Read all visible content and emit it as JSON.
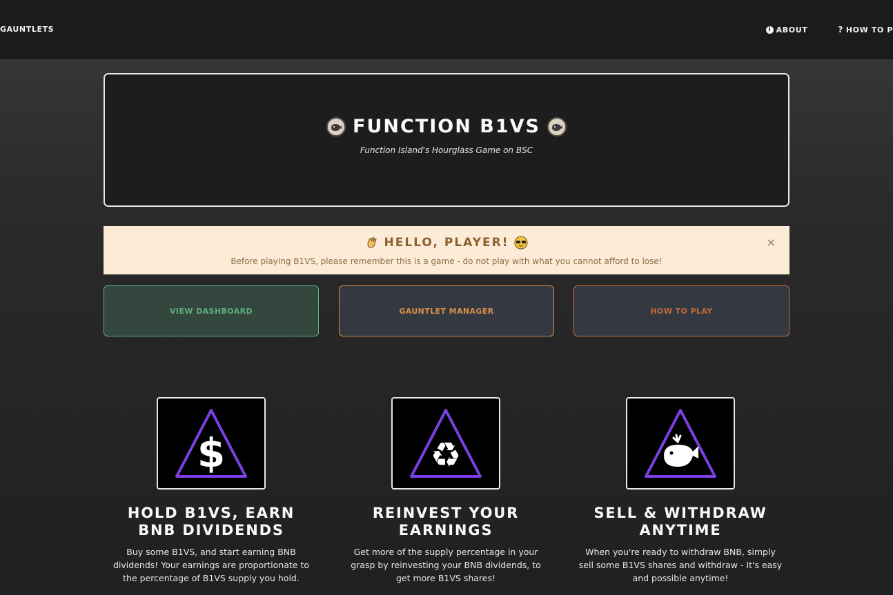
{
  "nav": {
    "left_label": "GAUNTLETS",
    "about_label": "ABOUT",
    "howto_label": "HOW TO P"
  },
  "hero": {
    "title": "FUNCTION B1VS",
    "subtitle": "Function Island's Hourglass Game on BSC"
  },
  "alert": {
    "title": "HELLO, PLAYER!",
    "text": "Before playing B1VS, please remember this is a game - do not play with what you cannot afford to lose!",
    "close": "×"
  },
  "buttons": {
    "dashboard": "VIEW DASHBOARD",
    "gauntlet": "GAUNTLET MANAGER",
    "howto": "HOW TO PLAY"
  },
  "features": [
    {
      "title": "HOLD B1VS, EARN BNB DIVIDENDS",
      "desc": "Buy some B1VS, and start earning BNB dividends! Your earnings are proportionate to the percentage of B1VS supply you hold.",
      "icon": "dollar-icon"
    },
    {
      "title": "REINVEST YOUR EARNINGS",
      "desc": "Get more of the supply percentage in your grasp by reinvesting your BNB dividends, to get more B1VS shares!",
      "icon": "recycle-icon"
    },
    {
      "title": "SELL & WITHDRAW ANYTIME",
      "desc": "When you're ready to withdraw BNB, simply sell some B1VS shares and withdraw - It's easy and possible anytime!",
      "icon": "whale-icon"
    }
  ],
  "colors": {
    "accent_purple": "#7b3fe4",
    "green": "#5fb383",
    "orange": "#d6904b",
    "alert_bg": "#fcebd6"
  }
}
